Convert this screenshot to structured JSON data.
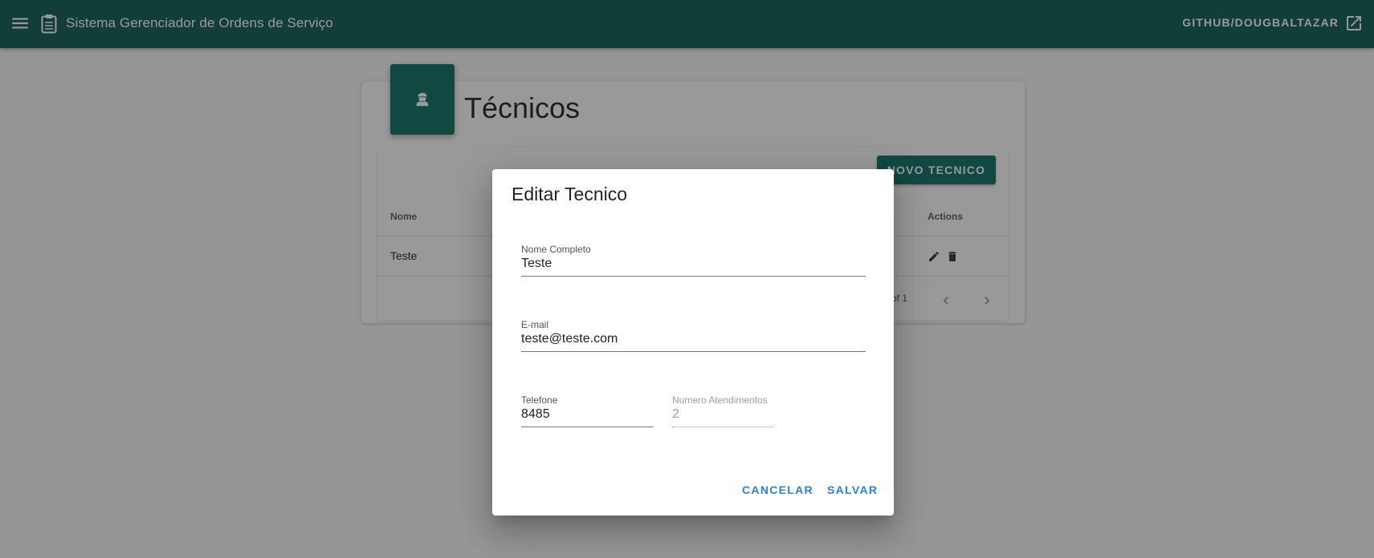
{
  "header": {
    "title": "Sistema Gerenciador de Ordens de Serviço",
    "github_link": "GITHUB/DOUGBALTAZAR",
    "icons": [
      "menu-icon",
      "clipboard-icon",
      "open-in-new-icon"
    ],
    "color": "#1d685f"
  },
  "page": {
    "title": "Técnicos",
    "header_icon": "engineer-icon",
    "new_button": "NOVO TECNICO",
    "table": {
      "columns": [
        "Nome",
        "Actions"
      ],
      "rows": [
        {
          "nome": "Teste",
          "actions": [
            "edit-icon",
            "delete-icon"
          ]
        }
      ]
    },
    "pagination": {
      "range_fragment": "of 1"
    }
  },
  "dialog": {
    "title": "Editar Tecnico",
    "fields": {
      "nome": {
        "label": "Nome Completo",
        "value": "Teste"
      },
      "email": {
        "label": "E-mail",
        "value": "teste@teste.com"
      },
      "telefone": {
        "label": "Telefone",
        "value": "8485"
      },
      "atendimentos": {
        "label": "Numero Atendimentos",
        "value": "2",
        "disabled": true
      }
    },
    "cancel": "CANCELAR",
    "save": "SALVAR",
    "accent": "#2f7fcf"
  }
}
